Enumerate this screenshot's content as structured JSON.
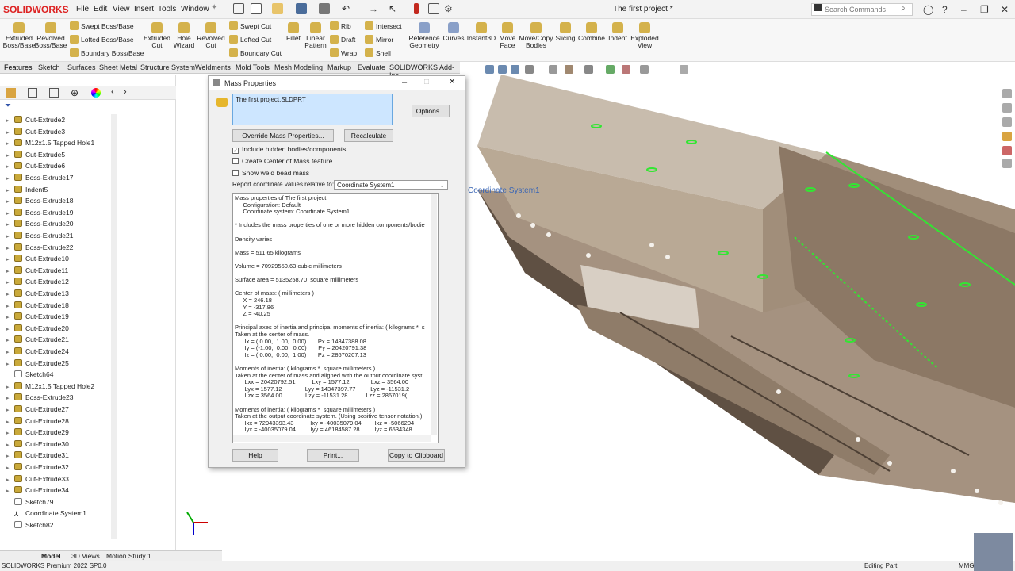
{
  "app": {
    "logo": "SOLIDWORKS",
    "doc_title": "The first project *",
    "search_placeholder": "Search Commands"
  },
  "menus": [
    "File",
    "Edit",
    "View",
    "Insert",
    "Tools",
    "Window"
  ],
  "ribbon": {
    "big": [
      {
        "id": "extruded-boss",
        "label": "Extruded Boss/Base",
        "l1": "Extruded",
        "l2": "Boss/Base"
      },
      {
        "id": "revolved-boss",
        "label": "Revolved Boss/Base",
        "l1": "Revolved",
        "l2": "Boss/Base"
      },
      {
        "id": "extruded-cut",
        "label": "Extruded Cut",
        "l1": "Extruded",
        "l2": "Cut"
      },
      {
        "id": "hole-wizard",
        "label": "Hole Wizard",
        "l1": "Hole",
        "l2": "Wizard"
      },
      {
        "id": "revolved-cut",
        "label": "Revolved Cut",
        "l1": "Revolved",
        "l2": "Cut"
      },
      {
        "id": "fillet",
        "label": "Fillet",
        "l1": "Fillet",
        "l2": ""
      },
      {
        "id": "linear-pattern",
        "label": "Linear Pattern",
        "l1": "Linear",
        "l2": "Pattern"
      },
      {
        "id": "reference-geometry",
        "label": "Reference Geometry",
        "l1": "Reference",
        "l2": "Geometry"
      },
      {
        "id": "curves",
        "label": "Curves",
        "l1": "Curves",
        "l2": ""
      },
      {
        "id": "instant3d",
        "label": "Instant3D",
        "l1": "Instant3D",
        "l2": ""
      },
      {
        "id": "move-face",
        "label": "Move Face",
        "l1": "Move",
        "l2": "Face"
      },
      {
        "id": "move-copy-bodies",
        "label": "Move/Copy Bodies",
        "l1": "Move/Copy",
        "l2": "Bodies"
      },
      {
        "id": "slicing",
        "label": "Slicing",
        "l1": "Slicing",
        "l2": ""
      },
      {
        "id": "combine",
        "label": "Combine",
        "l1": "Combine",
        "l2": ""
      },
      {
        "id": "indent",
        "label": "Indent",
        "l1": "Indent",
        "l2": ""
      },
      {
        "id": "exploded-view",
        "label": "Exploded View",
        "l1": "Exploded",
        "l2": "View"
      }
    ],
    "small": {
      "swept_boss": "Swept Boss/Base",
      "lofted_boss": "Lofted Boss/Base",
      "boundary_boss": "Boundary Boss/Base",
      "swept_cut": "Swept Cut",
      "lofted_cut": "Lofted Cut",
      "boundary_cut": "Boundary Cut",
      "rib": "Rib",
      "draft": "Draft",
      "wrap": "Wrap",
      "intersect": "Intersect",
      "mirror": "Mirror",
      "shell": "Shell"
    }
  },
  "tabs": [
    "Features",
    "Sketch",
    "Surfaces",
    "Sheet Metal",
    "Structure System",
    "Weldments",
    "Mold Tools",
    "Mesh Modeling",
    "Markup",
    "Evaluate",
    "SOLIDWORKS Add-Ins"
  ],
  "tree": [
    {
      "label": "Cut-Extrude2",
      "type": "feat"
    },
    {
      "label": "Cut-Extrude3",
      "type": "feat"
    },
    {
      "label": "M12x1.5 Tapped Hole1",
      "type": "feat"
    },
    {
      "label": "Cut-Extrude5",
      "type": "feat"
    },
    {
      "label": "Cut-Extrude6",
      "type": "feat"
    },
    {
      "label": "Boss-Extrude17",
      "type": "feat"
    },
    {
      "label": "Indent5",
      "type": "feat"
    },
    {
      "label": "Boss-Extrude18",
      "type": "feat"
    },
    {
      "label": "Boss-Extrude19",
      "type": "feat"
    },
    {
      "label": "Boss-Extrude20",
      "type": "feat"
    },
    {
      "label": "Boss-Extrude21",
      "type": "feat"
    },
    {
      "label": "Boss-Extrude22",
      "type": "feat"
    },
    {
      "label": "Cut-Extrude10",
      "type": "feat"
    },
    {
      "label": "Cut-Extrude11",
      "type": "feat"
    },
    {
      "label": "Cut-Extrude12",
      "type": "feat"
    },
    {
      "label": "Cut-Extrude13",
      "type": "feat"
    },
    {
      "label": "Cut-Extrude18",
      "type": "feat"
    },
    {
      "label": "Cut-Extrude19",
      "type": "feat"
    },
    {
      "label": "Cut-Extrude20",
      "type": "feat"
    },
    {
      "label": "Cut-Extrude21",
      "type": "feat"
    },
    {
      "label": "Cut-Extrude24",
      "type": "feat"
    },
    {
      "label": "Cut-Extrude25",
      "type": "feat"
    },
    {
      "label": "Sketch64",
      "type": "sketch"
    },
    {
      "label": "M12x1.5 Tapped Hole2",
      "type": "feat"
    },
    {
      "label": "Boss-Extrude23",
      "type": "feat"
    },
    {
      "label": "Cut-Extrude27",
      "type": "feat"
    },
    {
      "label": "Cut-Extrude28",
      "type": "feat"
    },
    {
      "label": "Cut-Extrude29",
      "type": "feat"
    },
    {
      "label": "Cut-Extrude30",
      "type": "feat"
    },
    {
      "label": "Cut-Extrude31",
      "type": "feat"
    },
    {
      "label": "Cut-Extrude32",
      "type": "feat"
    },
    {
      "label": "Cut-Extrude33",
      "type": "feat"
    },
    {
      "label": "Cut-Extrude34",
      "type": "feat"
    },
    {
      "label": "Sketch79",
      "type": "sketch"
    },
    {
      "label": "Coordinate System1",
      "type": "coord"
    },
    {
      "label": "Sketch82",
      "type": "sketch"
    }
  ],
  "bottom_tabs": [
    "Model",
    "3D Views",
    "Motion Study 1"
  ],
  "status": {
    "left": "SOLIDWORKS Premium 2022 SP0.0",
    "mode": "Editing Part",
    "units": "MMG"
  },
  "viewport": {
    "coord_label": "Coordinate System1"
  },
  "dialog": {
    "title": "Mass Properties",
    "file": "The first project.SLDPRT",
    "options": "Options...",
    "override": "Override Mass Properties...",
    "recalculate": "Recalculate",
    "chk_hidden": "Include hidden bodies/components",
    "chk_com": "Create Center of Mass feature",
    "chk_weld": "Show weld bead mass",
    "report_label": "Report coordinate values relative to:",
    "coord_system": "Coordinate System1",
    "help": "Help",
    "print": "Print...",
    "copy": "Copy to Clipboard",
    "results": [
      "Mass properties of The first project",
      "     Configuration: Default",
      "     Coordinate system: Coordinate System1",
      "",
      "* Includes the mass properties of one or more hidden components/bodie",
      "",
      "Density varies",
      "",
      "Mass = 511.65 kilograms",
      "",
      "Volume = 70929550.63 cubic millimeters",
      "",
      "Surface area = 5135258.70  square millimeters",
      "",
      "Center of mass: ( millimeters )",
      "     X = 246.18",
      "     Y = -317.86",
      "     Z = -40.25",
      "",
      "Principal axes of inertia and principal moments of inertia: ( kilograms *  s",
      "Taken at the center of mass.",
      "      Ix = ( 0.00,  1.00,  0.00)       Px = 14347388.08",
      "      Iy = (-1.00,  0.00,  0.00)       Py = 20420791.38",
      "      Iz = ( 0.00,  0.00,  1.00)       Pz = 28670207.13",
      "",
      "Moments of inertia: ( kilograms *  square millimeters )",
      "Taken at the center of mass and aligned with the output coordinate syst",
      "      Lxx = 20420792.51          Lxy = 1577.12             Lxz = 3564.00",
      "      Lyx = 1577.12              Lyy = 14347397.77         Lyz = -11531.2",
      "      Lzx = 3564.00              Lzy = -11531.28           Lzz = 2867019(",
      "",
      "Moments of inertia: ( kilograms *  square millimeters )",
      "Taken at the output coordinate system. (Using positive tensor notation.)",
      "      Ixx = 72943393.43          Ixy = -40035079.04        Ixz = -5066204",
      "      Iyx = -40035079.04         Iyy = 46184587.28         Iyz = 6534348."
    ]
  },
  "colors": {
    "accent": "#0078d7",
    "part": "#b7a592",
    "part_dark": "#5e4f42",
    "edge_green": "#32e632"
  }
}
